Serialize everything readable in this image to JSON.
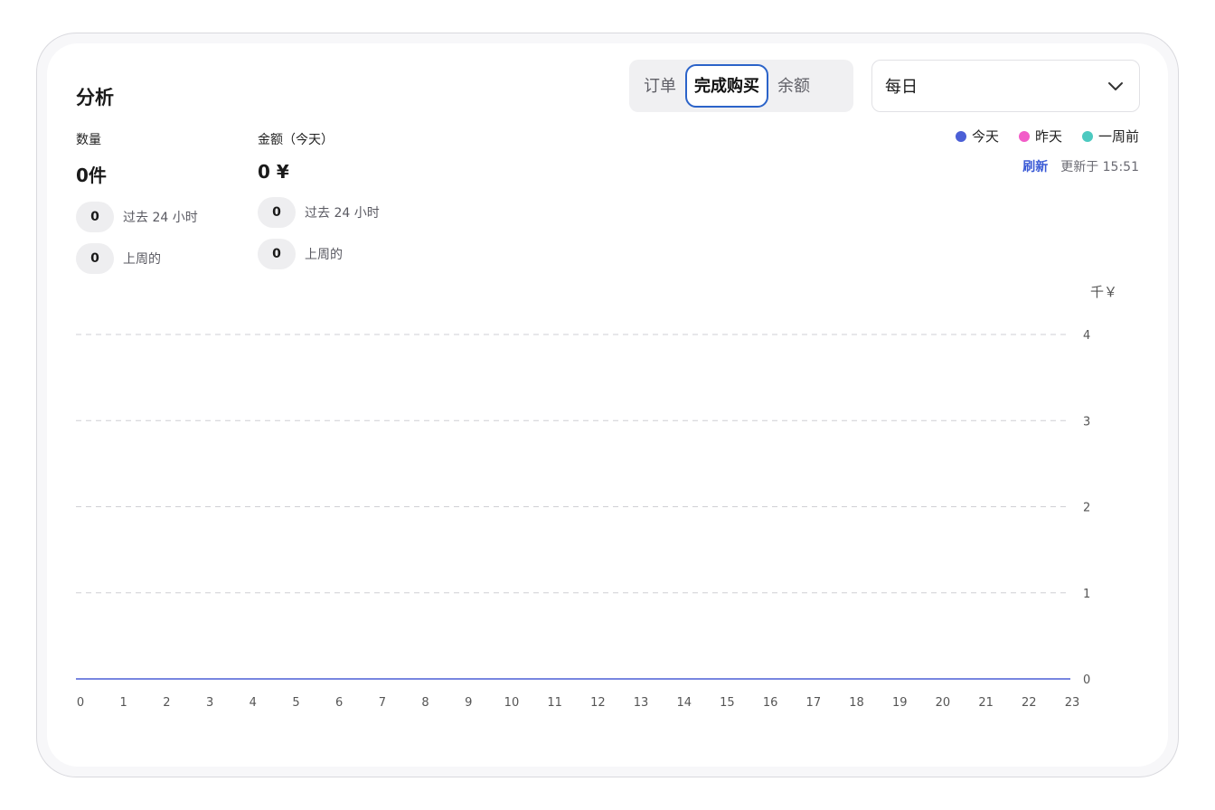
{
  "header": {
    "title": "分析",
    "tabs": [
      {
        "label": "订单",
        "active": false
      },
      {
        "label": "完成购买",
        "active": true
      },
      {
        "label": "余额",
        "active": false
      }
    ],
    "period_select": {
      "value": "每日",
      "icon": "chevron-down-icon"
    }
  },
  "metrics": [
    {
      "label": "数量",
      "value": "0件",
      "stats": [
        {
          "value": "0",
          "label": "过去 24 小时"
        },
        {
          "value": "0",
          "label": "上周的"
        }
      ]
    },
    {
      "label": "金额（今天）",
      "value": "0 ¥",
      "stats": [
        {
          "value": "0",
          "label": "过去 24 小时"
        },
        {
          "value": "0",
          "label": "上周的"
        }
      ]
    }
  ],
  "legend": [
    {
      "label": "今天",
      "color": "#4b5fd6"
    },
    {
      "label": "昨天",
      "color": "#f25cc8"
    },
    {
      "label": "一周前",
      "color": "#4cc9c0"
    }
  ],
  "refresh": {
    "link": "刷新",
    "updated": "更新于 15:51"
  },
  "chart_data": {
    "type": "line",
    "y_unit": "千￥",
    "x": [
      0,
      1,
      2,
      3,
      4,
      5,
      6,
      7,
      8,
      9,
      10,
      11,
      12,
      13,
      14,
      15,
      16,
      17,
      18,
      19,
      20,
      21,
      22,
      23
    ],
    "y_ticks": [
      0,
      1,
      2,
      3,
      4
    ],
    "ylim": [
      0,
      4
    ],
    "grid": true,
    "series": [
      {
        "name": "今天",
        "color": "#4b5fd6",
        "values": [
          0,
          0,
          0,
          0,
          0,
          0,
          0,
          0,
          0,
          0,
          0,
          0,
          0,
          0,
          0,
          0,
          0,
          0,
          0,
          0,
          0,
          0,
          0,
          0
        ]
      }
    ]
  }
}
